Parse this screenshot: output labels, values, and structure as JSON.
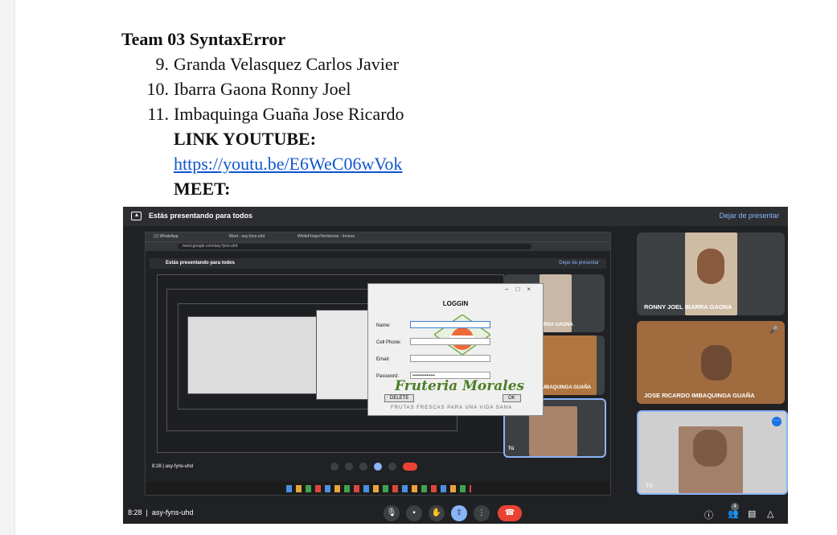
{
  "document": {
    "team_title": "Team 03 SyntaxError",
    "members": [
      {
        "number": "9.",
        "name": "Granda Velasquez Carlos Javier"
      },
      {
        "number": "10.",
        "name": "Ibarra Gaona Ronny Joel"
      },
      {
        "number": "11.",
        "name": "Imbaquinga Guaña Jose Ricardo"
      }
    ],
    "youtube_label": "LINK YOUTUBE:",
    "youtube_url": "https://youtu.be/E6WeC06wVok",
    "meet_label": "MEET:"
  },
  "meet": {
    "banner_text": "Estás presentando para todos",
    "stop_presenting": "Dejar de presentar",
    "time": "8:28",
    "meeting_code": "asy-fyns-uhd",
    "participants_count": "4",
    "participants": [
      {
        "name": "RONNY JOEL IBARRA GAONA"
      },
      {
        "name": "JOSE RICARDO IMBAQUINGA GUAÑA"
      },
      {
        "name": "Tú"
      }
    ],
    "inner": {
      "tab1": "(1) WhatsApp",
      "tab2": "Meet - asy-fyns-uhd",
      "tab3": "WhiteFringe/Verdureria - Innova",
      "url": "meet.google.com/asy-fyns-uhd",
      "banner_text": "Estás presentando para todos",
      "stop_presenting": "Dejar de presentar",
      "time": "8:28",
      "meeting_code": "asy-fyns-uhd",
      "tile_names": [
        "RRA GAONA",
        "MBAQUINGA GUAÑA",
        "Tú"
      ]
    },
    "login_window": {
      "title": "LOGGIN",
      "labels": [
        "Name:",
        "Cell Phone:",
        "Email:",
        "Password:"
      ],
      "password_value": "••••••••••••••••",
      "delete_label": "DELETE",
      "ok_label": "OK",
      "brand": "Fruteria Morales",
      "tagline": "FRUTAS FRESCAS PARA UNA VIDA SANA"
    }
  }
}
